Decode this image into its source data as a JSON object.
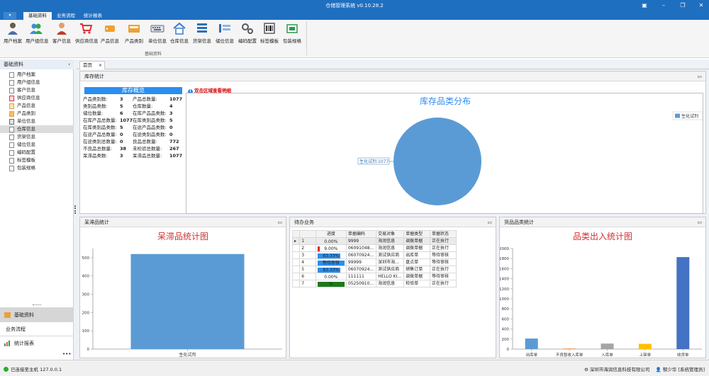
{
  "window": {
    "title": "仓储管理系统 v0.10.28.2",
    "controls": [
      "pin-icon",
      "minimize-icon",
      "restore-icon",
      "close-icon"
    ]
  },
  "menu": {
    "app_button": "▾",
    "tabs": [
      "基础资料",
      "业务流程",
      "统计报表"
    ],
    "active_tab": "基础资料"
  },
  "ribbon": {
    "group_label": "基础资料",
    "items": [
      {
        "label": "用户档案",
        "icon": "user-icon"
      },
      {
        "label": "用户组信息",
        "icon": "user-group-icon"
      },
      {
        "label": "客户信息",
        "icon": "customer-icon"
      },
      {
        "label": "供应商信息",
        "icon": "supplier-cart-icon"
      },
      {
        "label": "产品信息",
        "icon": "product-tag-icon"
      },
      {
        "label": "产品类别",
        "icon": "product-category-icon"
      },
      {
        "label": "单位信息",
        "icon": "unit-keyboard-icon"
      },
      {
        "label": "仓库信息",
        "icon": "warehouse-house-icon"
      },
      {
        "label": "货架信息",
        "icon": "shelf-icon"
      },
      {
        "label": "储位信息",
        "icon": "storage-location-icon"
      },
      {
        "label": "编码配置",
        "icon": "code-config-gears-icon"
      },
      {
        "label": "标签模板",
        "icon": "label-template-icon"
      },
      {
        "label": "包装规格",
        "icon": "packaging-icon"
      }
    ]
  },
  "sidebar": {
    "header": "基础资料",
    "items": [
      "用户档案",
      "用户组信息",
      "客户信息",
      "供应商信息",
      "产品信息",
      "产品类别",
      "单位信息",
      "仓库信息",
      "货架信息",
      "储位信息",
      "编码配置",
      "标签模板",
      "包装规格"
    ],
    "selected": "仓库信息",
    "nav_buttons": [
      "基础资料",
      "业务流程",
      "统计报表"
    ],
    "selected_nav": "基础资料",
    "more": "•••"
  },
  "doc_tab": {
    "label": "首页",
    "close": "×"
  },
  "inventory": {
    "panel_title": "库存统计",
    "overview_title": "库存概览",
    "rows": [
      {
        "l1": "产品类别数:",
        "v1": "3",
        "l2": "产品总数量:",
        "v2": "1077"
      },
      {
        "l1": "类别品类数:",
        "v1": "5",
        "l2": "仓库数量:",
        "v2": "4"
      },
      {
        "l1": "储位数量:",
        "v1": "6",
        "l2": "在库产品品类数:",
        "v2": "3"
      },
      {
        "l1": "在库产品总数量:",
        "v1": "1077",
        "l2": "在库类别品类数:",
        "v2": "5"
      },
      {
        "l1": "在库类别品类数:",
        "v1": "5",
        "l2": "在途产品品类数:",
        "v2": "0"
      },
      {
        "l1": "在途产品总数量:",
        "v1": "0",
        "l2": "在途类别品类数:",
        "v2": "0"
      },
      {
        "l1": "在途类别总数量:",
        "v1": "0",
        "l2": "良品总数量:",
        "v2": "772"
      },
      {
        "l1": "不良品总数量:",
        "v1": "38",
        "l2": "未检验总数量:",
        "v2": "267"
      },
      {
        "l1": "呆滞品类数:",
        "v1": "3",
        "l2": "呆滞品总数量:",
        "v2": "1077"
      }
    ],
    "hint": "双击区域查看明细",
    "hint_icon": "info-icon"
  },
  "slow_panel": {
    "title": "呆滞品统计"
  },
  "pending_panel": {
    "title": "待办业务"
  },
  "category_panel": {
    "title": "货品品类统计"
  },
  "pending_table": {
    "headers": [
      "进度",
      "单据编码",
      "交易对象",
      "单据类型",
      "单据状态"
    ],
    "rows": [
      {
        "idx": "1",
        "progress": "0.00%",
        "pct": 0,
        "color": "#2a8ef0",
        "code": "9999",
        "party": "海润信息",
        "type": "调拨单据",
        "status": "正在执行"
      },
      {
        "idx": "2",
        "progress": "9.00%",
        "pct": 9,
        "color": "#e02020",
        "code": "06091048...",
        "party": "海润信息",
        "type": "调拨单据",
        "status": "正在执行"
      },
      {
        "idx": "3",
        "progress": "83.33%",
        "pct": 83.33,
        "color": "#2a8ef0",
        "code": "06070924...",
        "party": "测试供应商",
        "type": "出库单",
        "status": "等待审核"
      },
      {
        "idx": "4",
        "progress": "等待审核",
        "pct": 100,
        "color": "#2a8ef0",
        "code": "99999",
        "party": "深圳市海...",
        "type": "盘点单",
        "status": "等待审核"
      },
      {
        "idx": "5",
        "progress": "83.33%",
        "pct": 83.33,
        "color": "#2a8ef0",
        "code": "06070924...",
        "party": "测试供应商",
        "type": "销售订单",
        "status": "正在执行"
      },
      {
        "idx": "6",
        "progress": "0.00%",
        "pct": 0,
        "color": "#2a8ef0",
        "code": "111111",
        "party": "HELLO KI...",
        "type": "调拨单据",
        "status": "等待审核"
      },
      {
        "idx": "7",
        "progress": "%",
        "pct": 100,
        "color": "#1a7a1a",
        "code": "05250910...",
        "party": "海润信息",
        "type": "检验单",
        "status": "正在执行"
      }
    ]
  },
  "status_bar": {
    "connection": "已连接至主机 127.0.0.1",
    "company": "深圳市海润信息科技有限公司",
    "user": "郁少华 [系统管理员]"
  },
  "chart_data": [
    {
      "type": "pie",
      "title": "库存品类分布",
      "labels": [
        "生化试剂"
      ],
      "values": [
        1077
      ],
      "slice_label": "生化试剂:1077",
      "legend": [
        "生化试剂"
      ],
      "legend_position": "top-right",
      "colors": [
        "#5b9bd5"
      ]
    },
    {
      "type": "bar",
      "title": "呆滞品统计图",
      "categories": [
        "生化试剂"
      ],
      "values": [
        520
      ],
      "ylim": [
        0,
        550
      ],
      "yticks": [
        0,
        100,
        200,
        300,
        400,
        500
      ],
      "grid": false,
      "colors": [
        "#5b9bd5"
      ]
    },
    {
      "type": "bar",
      "title": "品类出入统计图",
      "categories": [
        "出库单",
        "不良暂收入库单",
        "入库单",
        "上架单",
        "收货单"
      ],
      "values": [
        210,
        10,
        110,
        105,
        1830
      ],
      "ylim": [
        0,
        2000
      ],
      "yticks": [
        0,
        200,
        400,
        600,
        800,
        1000,
        1200,
        1400,
        1600,
        1800,
        2000
      ],
      "grid": false,
      "colors": [
        "#5b9bd5",
        "#ed7d31",
        "#a5a5a5",
        "#ffc000",
        "#4472c4"
      ]
    }
  ]
}
